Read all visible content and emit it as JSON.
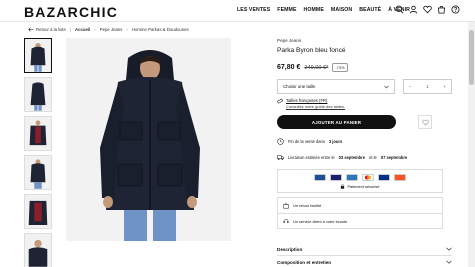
{
  "header": {
    "logo": "BAZARCHIC",
    "nav": [
      "LES VENTES",
      "FEMME",
      "HOMME",
      "MAISON",
      "BEAUTÉ",
      "À VENIR"
    ],
    "icons": [
      "search-icon",
      "user-icon",
      "heart-icon",
      "cart-icon",
      "help-icon"
    ]
  },
  "breadcrumb": {
    "back": "Retour à la liste",
    "items": [
      "Accueil",
      "Pepe Jeans",
      "Homme Parkas & Doudounes"
    ]
  },
  "product": {
    "brand": "Pepe Jeans",
    "title": "Parka Byron bleu foncé",
    "price": "67,80 €",
    "old_price": "249,00 €*",
    "discount": "-73%",
    "size_placeholder": "Choisir une taille",
    "quantity": "1",
    "qty_minus": "−",
    "qty_plus": "+",
    "size_guide_title": "Tailles françaises (FR)",
    "size_guide_link": "Consultez notre guide des tailles.",
    "add_to_cart": "AJOUTER AU PANIER",
    "sale_end_prefix": "Fin de la vente dans",
    "sale_end_value": "3 jours",
    "delivery_prefix": "Livraison estimée entre le",
    "delivery_from": "03 septembre",
    "delivery_mid": "et le",
    "delivery_to": "07 septembre",
    "secure_payment": "Paiement sécurisé",
    "service_return": "Un retour facilité",
    "service_client": "Un service client à votre écoute",
    "accordion": [
      "Description",
      "Composition et entretien"
    ]
  },
  "payment_cards": [
    {
      "name": "CB",
      "color": "#1d4d9c"
    },
    {
      "name": "VISA",
      "color": "#1a1f71"
    },
    {
      "name": "AMEX",
      "color": "#2e77bc"
    },
    {
      "name": "Mastercard",
      "color": "#eb001b"
    },
    {
      "name": "PayPal",
      "color": "#003087"
    },
    {
      "name": "Alma",
      "color": "#fa5022"
    }
  ],
  "colors": {
    "accent": "#111111",
    "jacket": "#1f2434",
    "jeans": "#6f93c6"
  }
}
